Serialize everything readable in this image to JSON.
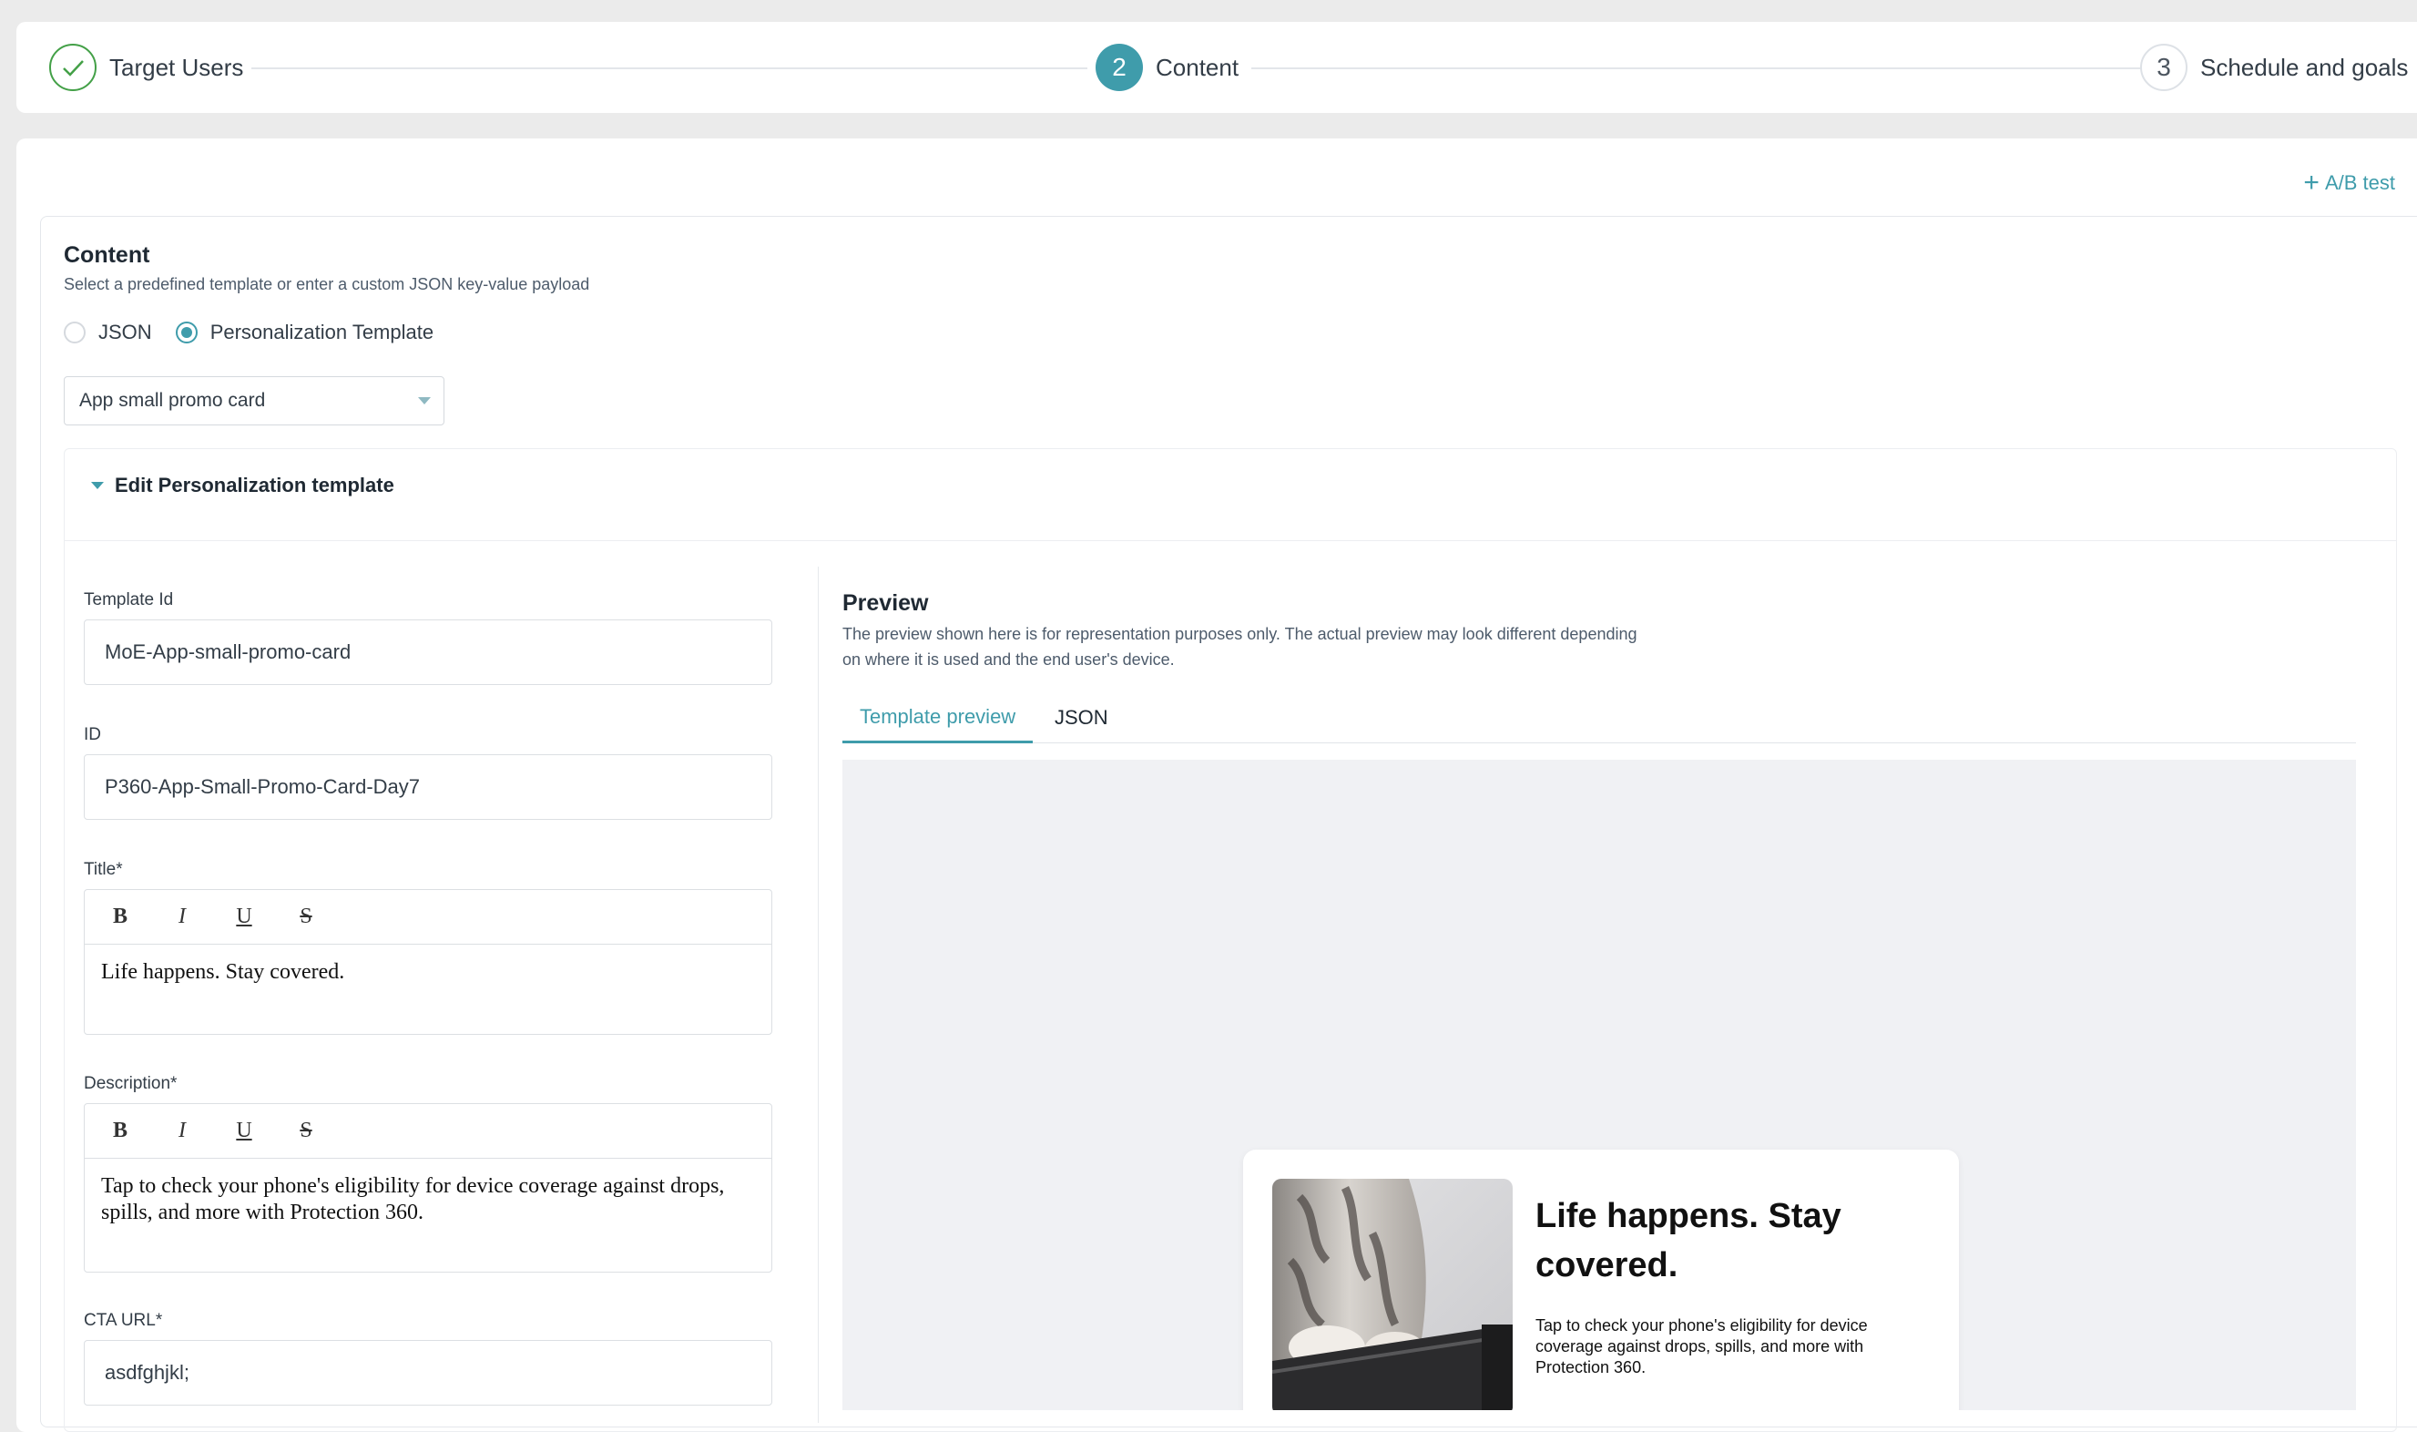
{
  "stepper": {
    "steps": [
      {
        "number": "",
        "label": "Target Users",
        "state": "done"
      },
      {
        "number": "2",
        "label": "Content",
        "state": "active"
      },
      {
        "number": "3",
        "label": "Schedule and goals",
        "state": "todo"
      }
    ]
  },
  "ab_test_label": "A/B test",
  "content": {
    "title": "Content",
    "subtitle": "Select a predefined template or enter a custom JSON key-value payload",
    "radio_options": [
      {
        "label": "JSON",
        "selected": false
      },
      {
        "label": "Personalization Template",
        "selected": true
      }
    ],
    "template_select_value": "App small promo card",
    "edit_header": "Edit Personalization template"
  },
  "form": {
    "template_id_label": "Template Id",
    "template_id_value": "MoE-App-small-promo-card",
    "id_label": "ID",
    "id_value": "P360-App-Small-Promo-Card-Day7",
    "title_label": "Title*",
    "title_value": "Life happens. Stay covered.",
    "description_label": "Description*",
    "description_value": "Tap to check your phone's eligibility for device coverage against drops, spills, and more with Protection 360.",
    "cta_url_label": "CTA URL*",
    "cta_url_value": "asdfghjkl;",
    "toolbar": {
      "bold": "B",
      "italic": "I",
      "underline": "U",
      "strike": "S"
    }
  },
  "preview": {
    "title": "Preview",
    "note": "The preview shown here is for representation purposes only. The actual preview may look different depending on where it is used and the end user's device.",
    "tabs": [
      "Template preview",
      "JSON"
    ],
    "active_tab": "Template preview",
    "card_title": "Life happens. Stay covered.",
    "card_description": "Tap to check your phone's eligibility for device coverage against drops, spills, and more with Protection 360."
  },
  "colors": {
    "accent": "#3f9cab",
    "success": "#43a047"
  }
}
